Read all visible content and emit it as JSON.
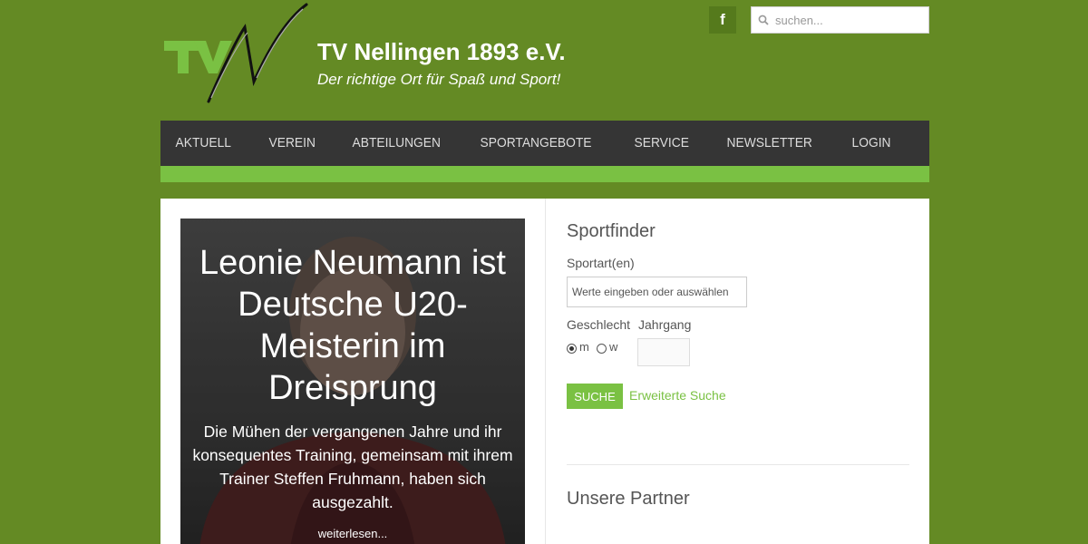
{
  "header": {
    "title": "TV Nellingen 1893 e.V.",
    "tagline": "Der richtige Ort für Spaß und Sport!",
    "facebook_label": "f",
    "search_placeholder": "suchen..."
  },
  "nav": {
    "items": [
      "AKTUELL",
      "VEREIN",
      "ABTEILUNGEN",
      "SPORTANGEBOTE",
      "SERVICE",
      "NEWSLETTER",
      "LOGIN"
    ]
  },
  "slider": {
    "title": "Leonie Neumann ist Deutsche U20-Meisterin im Dreisprung",
    "text": "Die Mühen der vergangenen Jahre und ihr konsequentes Training, gemeinsam mit ihrem Trainer Steffen Fruhmann, haben sich ausgezahlt.",
    "more_label": "weiterlesen..."
  },
  "sportfinder": {
    "heading": "Sportfinder",
    "sport_label": "Sportart(en)",
    "sport_placeholder": "Werte eingeben oder auswählen",
    "gender_label": "Geschlecht",
    "gender_options": [
      "m",
      "w"
    ],
    "gender_selected": "m",
    "year_label": "Jahrgang",
    "search_button": "SUCHE",
    "advanced_link": "Erweiterte Suche"
  },
  "partners": {
    "heading": "Unsere Partner"
  },
  "colors": {
    "background": "#648a24",
    "accent": "#7ac143",
    "nav_bg": "#353535"
  }
}
